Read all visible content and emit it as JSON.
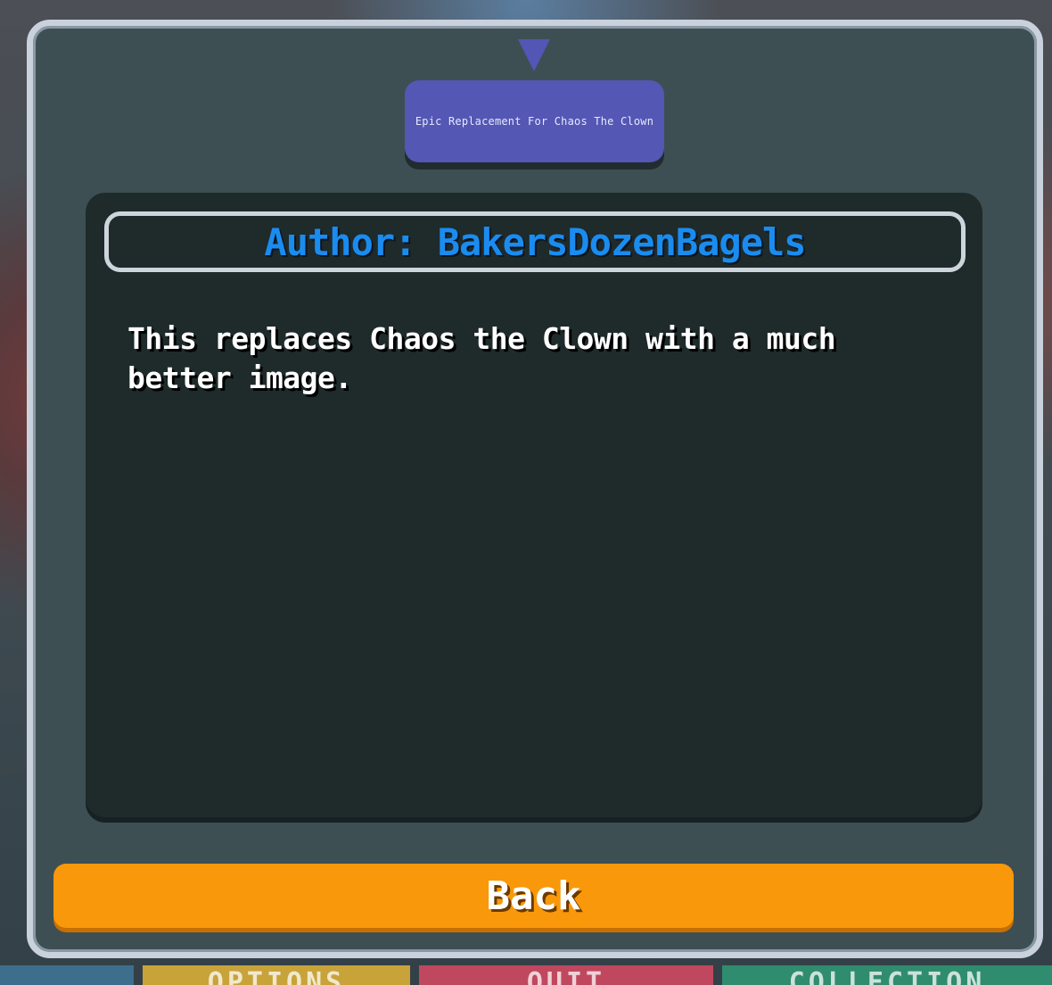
{
  "dialog": {
    "mod_title": "Epic Replacement For Chaos The Clown",
    "author_line": "Author: BakersDozenBagels",
    "description": "This replaces Chaos the Clown with a much better image.",
    "back_label": "Back"
  },
  "background_menu": {
    "tabs": [
      "",
      "OPTIONS",
      "QUIT",
      "COLLECTION"
    ]
  },
  "colors": {
    "chip": "#5457b3",
    "author_text": "#1a8cf0",
    "back_button": "#f9980a",
    "panel": "#1f2a2b",
    "dialog": "#3d4f53"
  }
}
